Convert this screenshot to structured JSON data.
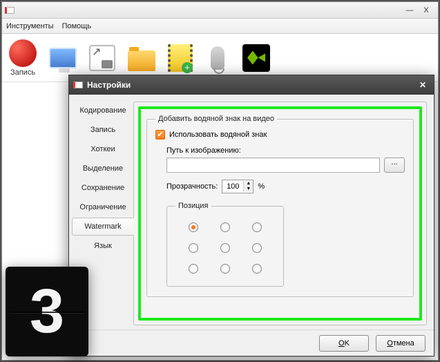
{
  "window_controls": {
    "min": "—",
    "close": "X"
  },
  "menu": {
    "tools": "Инструменты",
    "help": "Помощь"
  },
  "toolbar": {
    "record_label": "Запись"
  },
  "dialog": {
    "title": "Настройки",
    "tabs": [
      "Кодирование",
      "Запись",
      "Хоткеи",
      "Выделение",
      "Сохранение",
      "Ограничение",
      "Watermark",
      "Язык"
    ],
    "watermark": {
      "group_title": "Добавить водяной знак на видео",
      "use_label": "Использовать водяной знак",
      "use_checked": true,
      "path_label": "Путь к изображению:",
      "path_value": "",
      "browse_label": "...",
      "opacity_label": "Прозрачность:",
      "opacity_value": "100",
      "opacity_suffix": "%",
      "position_label": "Позиция",
      "position_selected": 0
    },
    "buttons": {
      "ok": "OK",
      "cancel": "Отмена",
      "ok_mnemonic": "O",
      "cancel_mnemonic": "О"
    }
  },
  "countdown": {
    "value": "3"
  }
}
